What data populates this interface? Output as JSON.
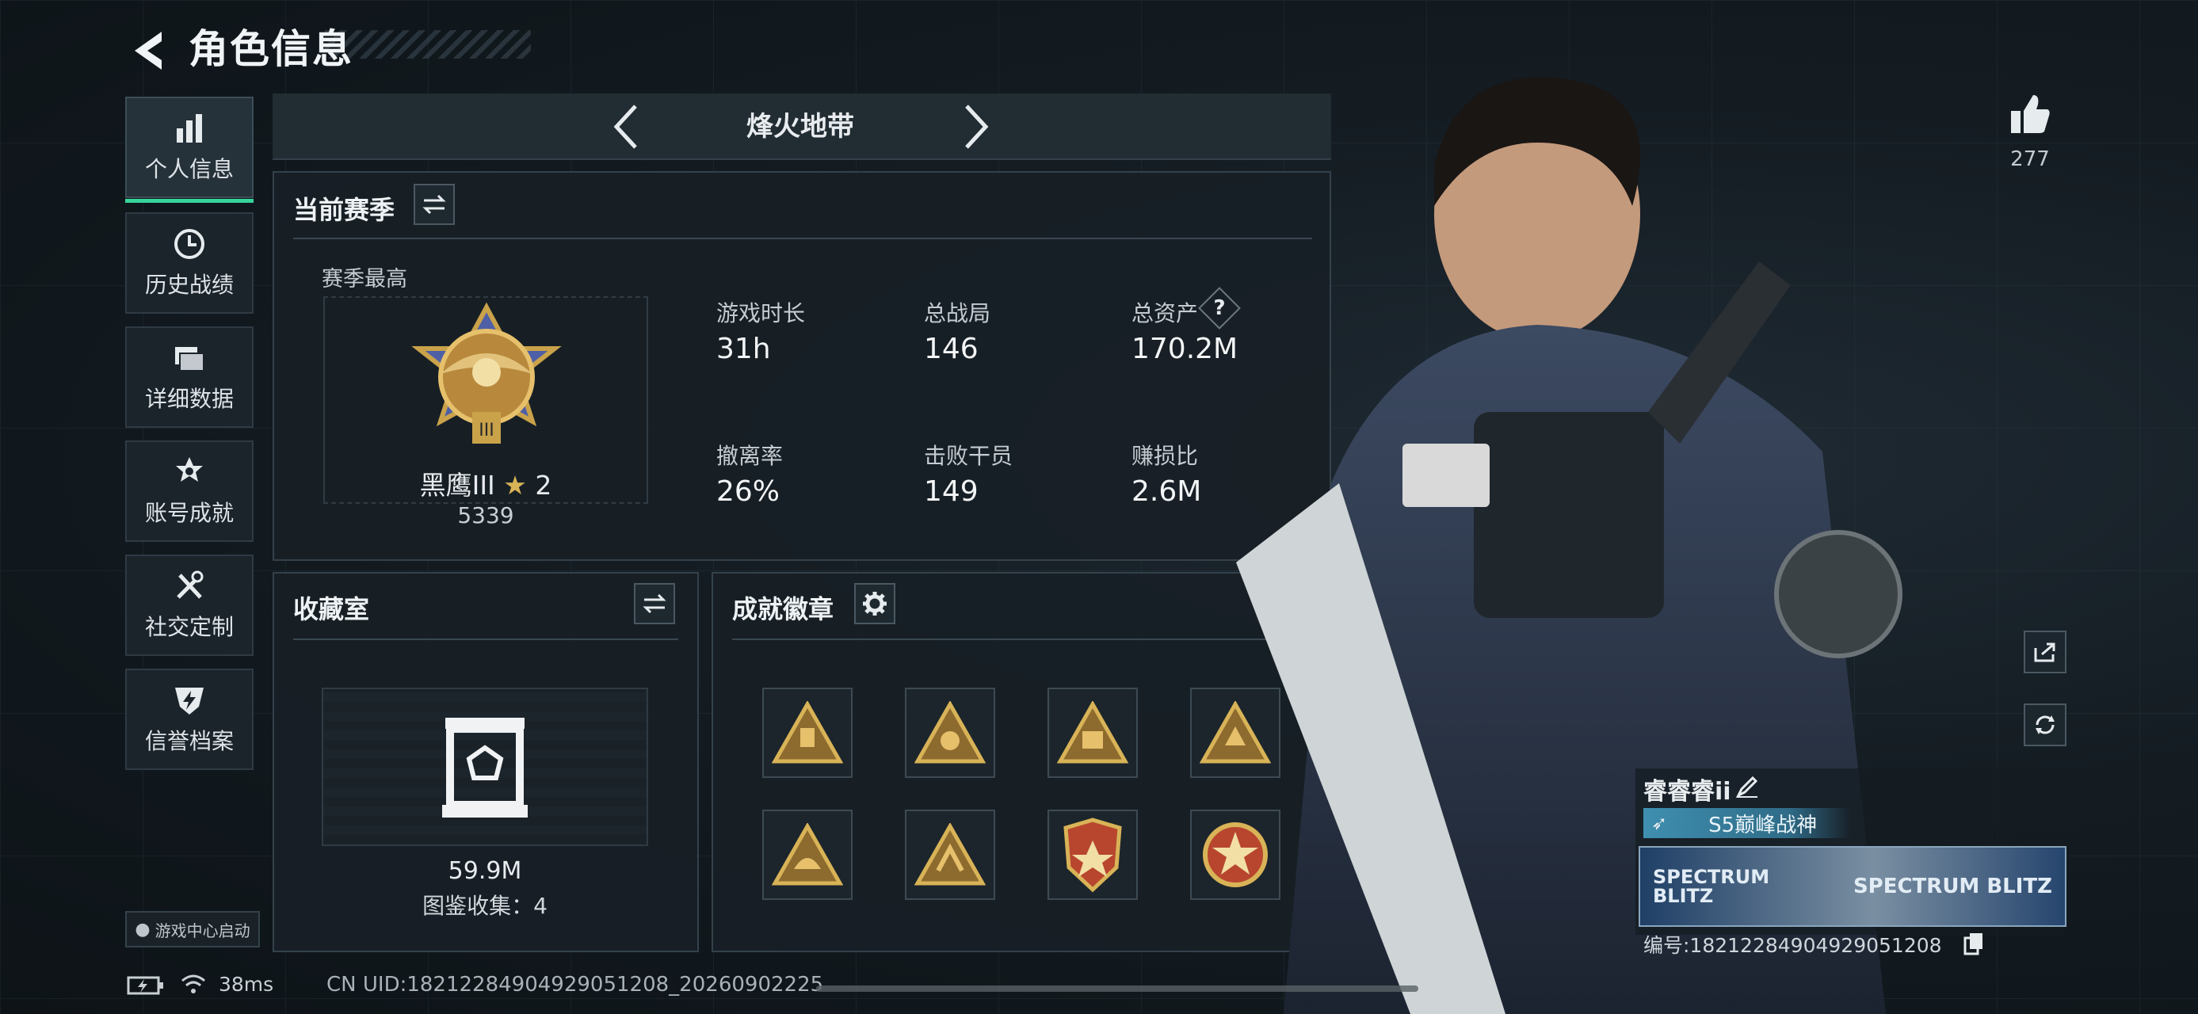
{
  "header": {
    "title": "角色信息"
  },
  "sidebar": {
    "items": [
      {
        "label": "个人信息",
        "icon": "bar-chart-icon",
        "active": true
      },
      {
        "label": "历史战绩",
        "icon": "clock-icon"
      },
      {
        "label": "详细数据",
        "icon": "folder-icon"
      },
      {
        "label": "账号成就",
        "icon": "medal-icon"
      },
      {
        "label": "社交定制",
        "icon": "tools-icon"
      },
      {
        "label": "信誉档案",
        "icon": "shield-lightning-icon"
      }
    ],
    "game_center": "游戏中心启动"
  },
  "mode_selector": {
    "label": "烽火地带"
  },
  "season": {
    "title": "当前赛季",
    "best_label": "赛季最高",
    "rank_name": "黑鹰III",
    "rank_stars": "2",
    "rank_points": "5339",
    "stats": [
      {
        "label": "游戏时长",
        "value": "31h"
      },
      {
        "label": "总战局",
        "value": "146"
      },
      {
        "label": "总资产",
        "value": "170.2M",
        "help": "?"
      },
      {
        "label": "撤离率",
        "value": "26%"
      },
      {
        "label": "击败干员",
        "value": "149"
      },
      {
        "label": "赚损比",
        "value": "2.6M"
      }
    ]
  },
  "collection": {
    "title": "收藏室",
    "value": "59.9M",
    "catalog": "图鉴收集：4"
  },
  "achievements": {
    "title": "成就徽章",
    "badge_count": 8
  },
  "likes": {
    "count": "277"
  },
  "player": {
    "name": "睿睿睿ii",
    "title": "S5巅峰战神",
    "card_text": "SPECTRUM BLITZ",
    "id_line": "编号:18212284904929051208"
  },
  "footer": {
    "ping": "38ms",
    "uid": "CN UID:18212284904929051208_20260902225"
  },
  "colors": {
    "accent": "#37d49b",
    "gold": "#c9a24a",
    "panel": "#182026"
  }
}
